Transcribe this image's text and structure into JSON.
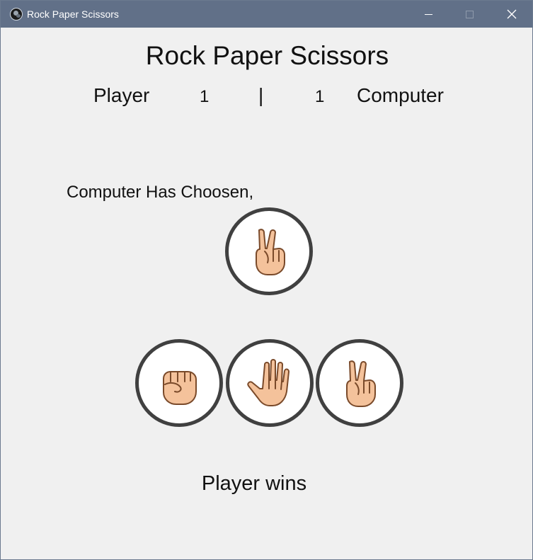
{
  "window": {
    "title": "Rock Paper Scissors"
  },
  "game": {
    "heading": "Rock Paper Scissors",
    "player_label": "Player",
    "player_score": "1",
    "separator": "|",
    "computer_score": "1",
    "computer_label": "Computer",
    "computer_choice_label": "Computer Has Choosen,",
    "computer_choice": "scissors",
    "options": [
      "rock",
      "paper",
      "scissors"
    ],
    "result": "Player wins"
  },
  "icons": {
    "computer_choice": "scissors-hand-icon",
    "rock": "rock-fist-icon",
    "paper": "paper-hand-icon",
    "scissors": "scissors-hand-icon"
  },
  "colors": {
    "titlebar": "#617088",
    "background": "#f0f0f0",
    "circle_border": "#404040",
    "skin": "#f4c29b",
    "skin_outline": "#7a4a2a"
  }
}
